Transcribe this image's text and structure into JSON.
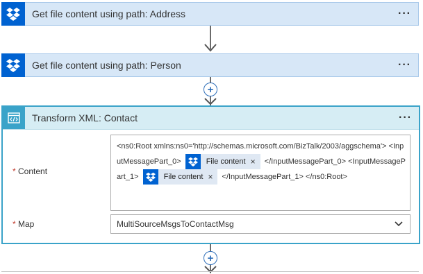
{
  "steps": [
    {
      "title": "Get file content using path: Address",
      "icon": "dropbox-icon"
    },
    {
      "title": "Get file content using path: Person",
      "icon": "dropbox-icon"
    }
  ],
  "menu_glyph": "···",
  "add_glyph": "+",
  "transform": {
    "title": "Transform XML: Contact",
    "icon": "code-window-icon",
    "content_label": "Content",
    "required_mark": "*",
    "map_label": "Map",
    "content": {
      "seg1": "<ns0:Root xmlns:ns0='http://schemas.microsoft.com/BizTalk/2003/aggschema'> <InputMessagePart_0>",
      "token1": "File content",
      "seg2": "</InputMessagePart_0> <InputMessagePart_1>",
      "token2": "File content",
      "seg3": "</InputMessagePart_1> </ns0:Root>"
    },
    "token_close": "×",
    "map_value": "MultiSourceMsgsToContactMsg"
  },
  "colors": {
    "dropbox_blue": "#0062d1",
    "action_header": "#d7e7f7",
    "transform_accent": "#3aa3c9",
    "transform_header": "#d6edf4"
  }
}
